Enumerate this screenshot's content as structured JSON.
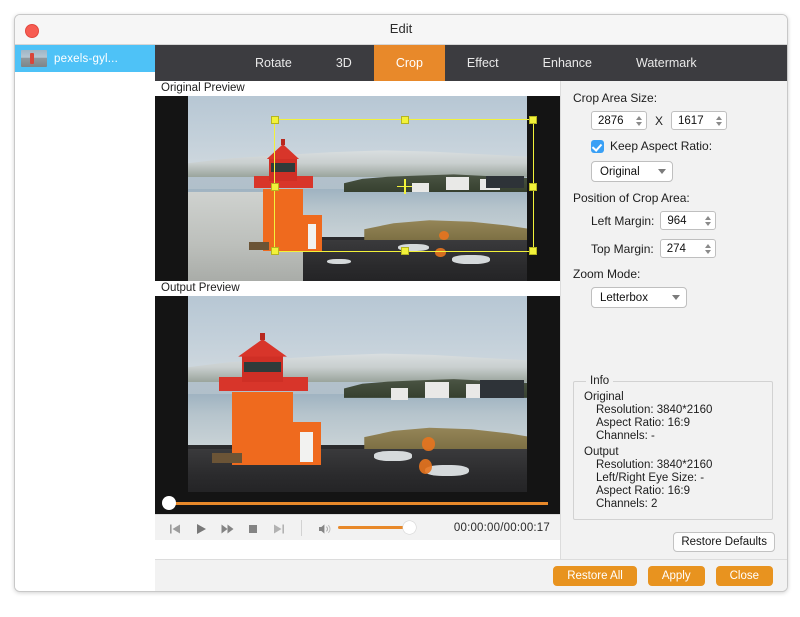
{
  "window": {
    "title": "Edit",
    "close_button": "close"
  },
  "sidebar": {
    "files": [
      {
        "name": "pexels-gyl...",
        "selected": true
      }
    ]
  },
  "tabs": [
    {
      "label": "Rotate",
      "active": false
    },
    {
      "label": "3D",
      "active": false
    },
    {
      "label": "Crop",
      "active": true
    },
    {
      "label": "Effect",
      "active": false
    },
    {
      "label": "Enhance",
      "active": false
    },
    {
      "label": "Watermark",
      "active": false
    }
  ],
  "previews": {
    "original_label": "Original Preview",
    "output_label": "Output Preview"
  },
  "transport": {
    "prev_label": "previous",
    "play_label": "play",
    "forward_label": "fast-forward",
    "stop_label": "stop",
    "next_label": "next",
    "volume_label": "volume",
    "timecode": "00:00:00/00:00:17"
  },
  "crop_panel": {
    "crop_area_size_label": "Crop Area Size:",
    "width": "2876",
    "x_separator": "X",
    "height": "1617",
    "keep_aspect_ratio_label": "Keep Aspect Ratio:",
    "keep_aspect_ratio_checked": true,
    "aspect_ratio_value": "Original",
    "aspect_ratio_options": [
      "Original"
    ],
    "position_label": "Position of Crop Area:",
    "left_margin_label": "Left Margin:",
    "left_margin": "964",
    "top_margin_label": "Top Margin:",
    "top_margin": "274",
    "zoom_mode_label": "Zoom Mode:",
    "zoom_mode_value": "Letterbox",
    "zoom_mode_options": [
      "Letterbox"
    ]
  },
  "info": {
    "caption": "Info",
    "original_heading": "Original",
    "original_lines": [
      "Resolution: 3840*2160",
      "Aspect Ratio: 16:9",
      "Channels: -"
    ],
    "output_heading": "Output",
    "output_lines": [
      "Resolution: 3840*2160",
      "Left/Right Eye Size: -",
      "Aspect Ratio: 16:9",
      "Channels: 2"
    ],
    "restore_defaults_label": "Restore Defaults"
  },
  "footer": {
    "restore_all_label": "Restore All",
    "apply_label": "Apply",
    "close_label": "Close"
  },
  "colors": {
    "accent_orange": "#e8931f",
    "tab_active": "#e8892a",
    "tab_bar": "#3c3c40",
    "selection_blue": "#4ec2f7",
    "crop_outline": "#f2f23a"
  }
}
